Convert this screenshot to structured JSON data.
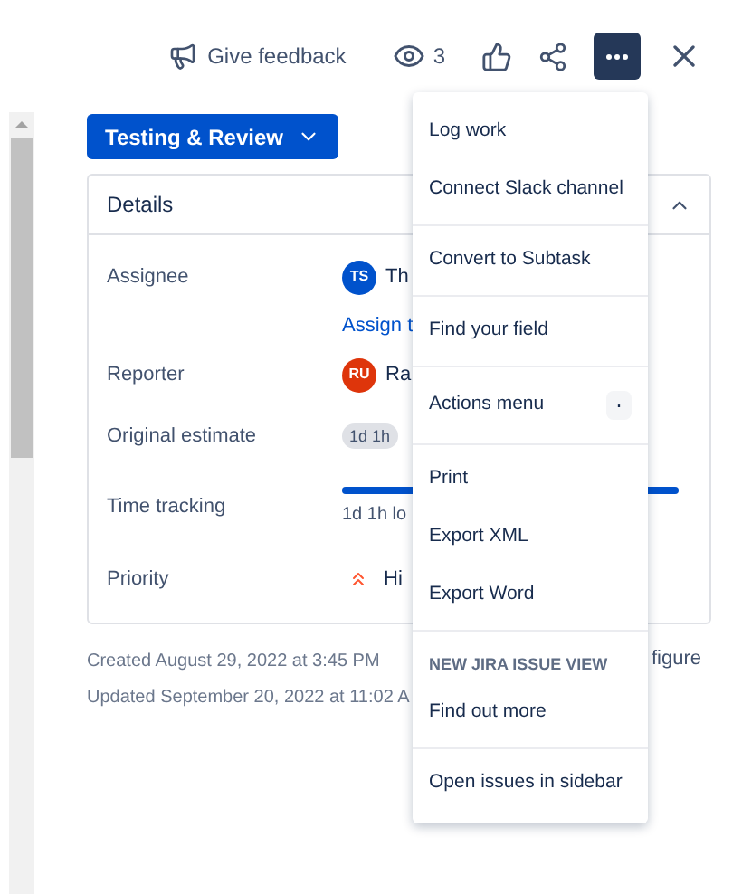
{
  "toolbar": {
    "feedback": "Give feedback",
    "watchers": "3",
    "more_selected": true
  },
  "status_button": "Testing & Review",
  "details": {
    "title": "Details",
    "expanded": true,
    "fields": [
      {
        "kind": "user",
        "label": "Assignee",
        "initials": "TS",
        "color": "#0052cc",
        "value": "Th"
      },
      {
        "kind": "link",
        "value": "Assign t"
      },
      {
        "kind": "user",
        "label": "Reporter",
        "initials": "RU",
        "color": "#de350b",
        "value": "Ra"
      },
      {
        "kind": "lozenge",
        "label": "Original estimate",
        "value": "1d 1h"
      },
      {
        "kind": "tracking",
        "label": "Time tracking",
        "value": "1d 1h lo",
        "level": 1
      },
      {
        "kind": "priority",
        "label": "Priority",
        "value": "Hi"
      }
    ]
  },
  "configure_link": "figure",
  "created": "Created August 29, 2022 at 3:45 PM",
  "updated": "Updated September 20, 2022 at 11:02 A",
  "menu": [
    {
      "kind": "item",
      "label": "Log work"
    },
    {
      "kind": "item",
      "label": "Connect Slack channel"
    },
    {
      "kind": "divider"
    },
    {
      "kind": "item",
      "label": "Convert to Subtask"
    },
    {
      "kind": "divider"
    },
    {
      "kind": "item",
      "label": "Find your field"
    },
    {
      "kind": "divider"
    },
    {
      "kind": "shortcut",
      "label": "Actions menu",
      "key": "."
    },
    {
      "kind": "divider"
    },
    {
      "kind": "item",
      "label": "Print"
    },
    {
      "kind": "item",
      "label": "Export XML"
    },
    {
      "kind": "item",
      "label": "Export Word"
    },
    {
      "kind": "divider"
    },
    {
      "kind": "heading",
      "label": "NEW JIRA ISSUE VIEW"
    },
    {
      "kind": "item",
      "label": "Find out more"
    },
    {
      "kind": "divider"
    },
    {
      "kind": "item",
      "label": "Open issues in sidebar"
    }
  ]
}
